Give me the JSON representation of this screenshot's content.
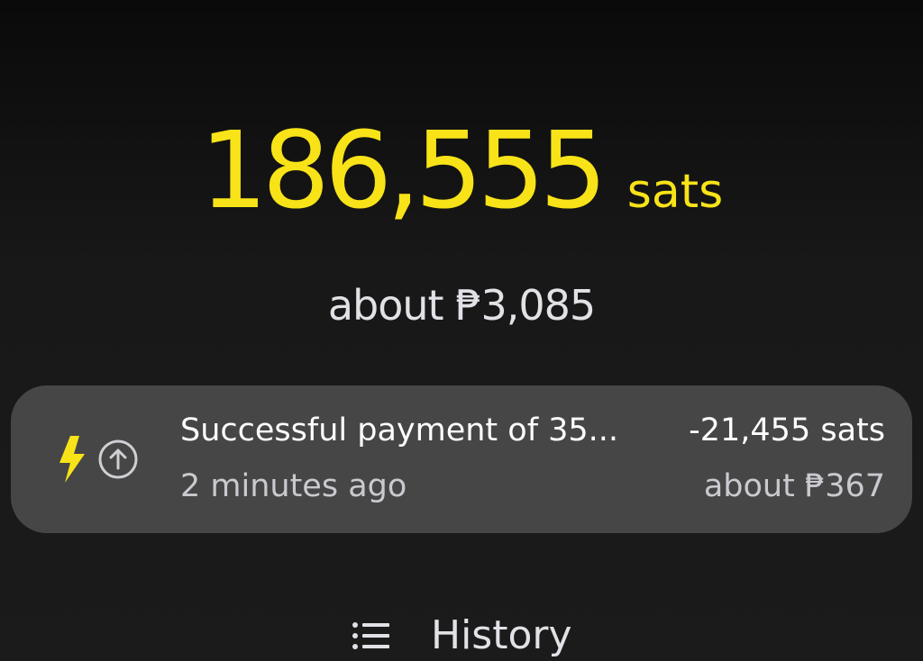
{
  "balance": {
    "amount": "186,555",
    "unit": "sats",
    "fiat": "about ₱3,085"
  },
  "transaction": {
    "type_icon": "lightning-bolt-icon",
    "direction_icon": "arrow-up-circle-icon",
    "title": "Successful payment of 35...",
    "time": "2 minutes ago",
    "amount": "-21,455 sats",
    "fiat": "about ₱367"
  },
  "history": {
    "icon": "list-icon",
    "label": "History"
  },
  "colors": {
    "accent": "#f8e318",
    "background": "#161616",
    "card": "#464646",
    "text_primary": "#ffffff",
    "text_secondary": "#c9c9cf"
  }
}
